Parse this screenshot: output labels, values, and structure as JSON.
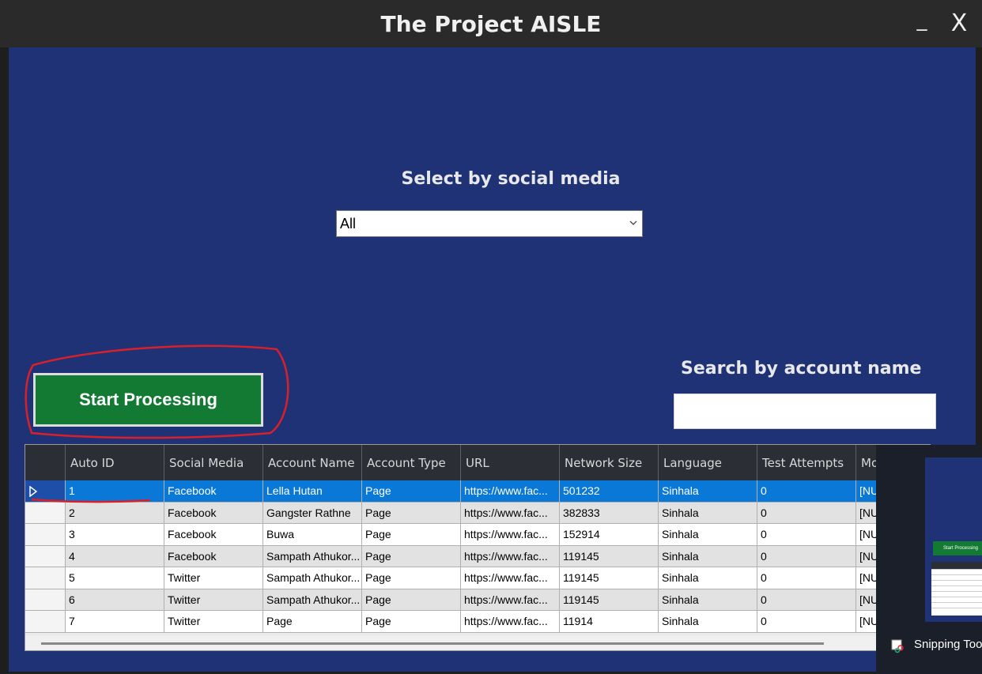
{
  "window": {
    "title": "The Project AISLE",
    "minimize_label": "_",
    "close_label": "X"
  },
  "filter": {
    "label": "Select by social media",
    "selected": "All"
  },
  "actions": {
    "start_label": "Start Processing"
  },
  "search": {
    "label": "Search by account name",
    "value": ""
  },
  "table": {
    "columns": [
      "Auto ID",
      "Social Media",
      "Account Name",
      "Account Type",
      "URL",
      "Network Size",
      "Language",
      "Test Attempts",
      "Mo"
    ],
    "rows": [
      [
        "1",
        "Facebook",
        "Lella Hutan",
        "Page",
        "https://www.fac...",
        "501232",
        "Sinhala",
        "0",
        "[NU"
      ],
      [
        "2",
        "Facebook",
        "Gangster Rathne",
        "Page",
        "https://www.fac...",
        "382833",
        "Sinhala",
        "0",
        "[NU"
      ],
      [
        "3",
        "Facebook",
        "Buwa",
        "Page",
        "https://www.fac...",
        "152914",
        "Sinhala",
        "0",
        "[NU"
      ],
      [
        "4",
        "Facebook",
        "Sampath Athukor...",
        "Page",
        "https://www.fac...",
        "119145",
        "Sinhala",
        "0",
        "[NU"
      ],
      [
        "5",
        "Twitter",
        "Sampath Athukor...",
        "Page",
        "https://www.fac...",
        "119145",
        "Sinhala",
        "0",
        "[NU"
      ],
      [
        "6",
        "Twitter",
        "Sampath Athukor...",
        "Page",
        "https://www.fac...",
        "119145",
        "Sinhala",
        "0",
        "[NU"
      ],
      [
        "7",
        "Twitter",
        "Page",
        "Page",
        "https://www.fac...",
        "11914",
        "Sinhala",
        "0",
        "[NU"
      ]
    ],
    "selected_row": 0
  },
  "taskbar": {
    "app_label": "Snipping Too",
    "preview_button": "Start Processing"
  },
  "colors": {
    "background": "#1f3276",
    "titlebar": "#2a2a2a",
    "button": "#137a34",
    "selection": "#0a78d7",
    "annotation": "#d9202a"
  }
}
